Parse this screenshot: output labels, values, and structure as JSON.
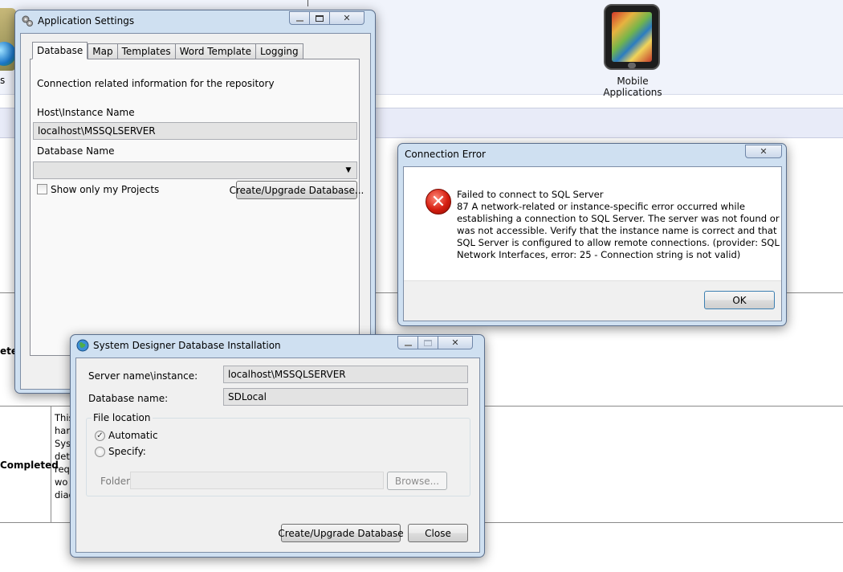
{
  "background": {
    "mobile_label": "Mobile Applications",
    "partial_completed": "Completed",
    "partial_eted": "eted",
    "partial_s": "s",
    "desc_fragments": [
      "This",
      "har",
      "Sys",
      "det",
      "req",
      "wo",
      "diag"
    ]
  },
  "app_settings": {
    "title": "Application Settings",
    "tabs": [
      {
        "label": "Database",
        "active": true
      },
      {
        "label": "Map"
      },
      {
        "label": "Templates"
      },
      {
        "label": "Word Template"
      },
      {
        "label": "Logging"
      }
    ],
    "intro": "Connection related information for the repository",
    "host_label": "Host\\Instance Name",
    "host_value": "localhost\\MSSQLSERVER",
    "db_label": "Database Name",
    "db_value": "",
    "show_only_label": "Show only my Projects",
    "show_only_checked": false,
    "create_button": "Create/Upgrade Database..."
  },
  "connection_error": {
    "title": "Connection Error",
    "message_lines": [
      "Failed to connect to SQL Server",
      "87 A network-related or instance-specific error occurred while",
      "establishing a connection to SQL Server. The server was not found or",
      "was not accessible. Verify that the instance name is correct and that",
      "SQL Server is configured to allow remote connections. (provider: SQL",
      "Network Interfaces, error: 25 - Connection string is not valid)"
    ],
    "ok_button": "OK"
  },
  "sd_install": {
    "title": "System Designer Database Installation",
    "server_label": "Server name\\instance:",
    "server_value": "localhost\\MSSQLSERVER",
    "dbname_label": "Database name:",
    "dbname_value": "SDLocal",
    "file_location_label": "File location",
    "automatic_label": "Automatic",
    "specify_label": "Specify:",
    "selected_option": "Automatic",
    "folder_label": "Folder:",
    "folder_value": "",
    "browse_button": "Browse...",
    "create_button": "Create/Upgrade Database",
    "close_button": "Close"
  },
  "colors": {
    "window_frame": "#cfe0f1",
    "error_red": "#d51e10"
  },
  "icons": {
    "settings_window": "gear-icon",
    "error": "error-x-icon",
    "install_window": "globe-icon",
    "mobile": "tablet-map-icon"
  }
}
